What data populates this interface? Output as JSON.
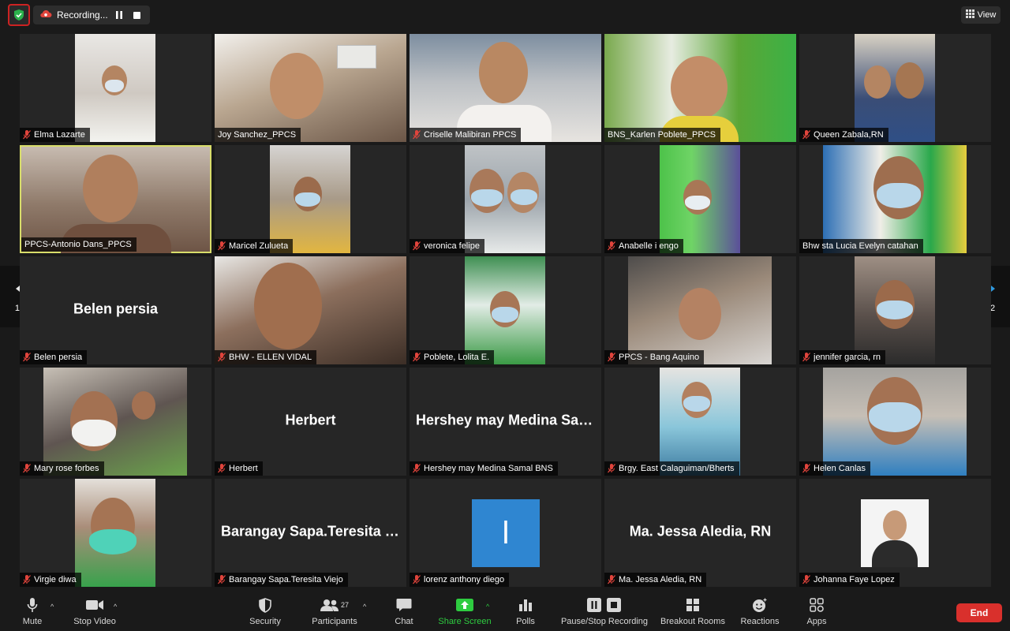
{
  "topbar": {
    "recording_label": "Recording...",
    "view_label": "View"
  },
  "navigation": {
    "page_left": "1/2",
    "page_right": "1/2"
  },
  "participants": [
    {
      "name": "Elma Lazarte",
      "mic_muted": true
    },
    {
      "name": "Joy Sanchez_PPCS",
      "mic_muted": false
    },
    {
      "name": "Criselle Malibiran PPCS",
      "mic_muted": true
    },
    {
      "name": "BNS_Karlen Poblete_PPCS",
      "mic_muted": false
    },
    {
      "name": "Queen Zabala,RN",
      "mic_muted": true
    },
    {
      "name": "PPCS-Antonio Dans_PPCS",
      "mic_muted": false
    },
    {
      "name": "Maricel Zulueta",
      "mic_muted": true
    },
    {
      "name": "veronica felipe",
      "mic_muted": true
    },
    {
      "name": "Anabelle i engo",
      "mic_muted": true
    },
    {
      "name": "Bhw sta Lucia Evelyn catahan",
      "mic_muted": false
    },
    {
      "name": "Belen persia",
      "mic_muted": true,
      "center_label": "Belen persia"
    },
    {
      "name": "BHW - ELLEN VIDAL",
      "mic_muted": true
    },
    {
      "name": "Poblete, Lolita E.",
      "mic_muted": true
    },
    {
      "name": "PPCS - Bang Aquino",
      "mic_muted": true
    },
    {
      "name": "jennifer garcia, rn",
      "mic_muted": true
    },
    {
      "name": "Mary rose forbes",
      "mic_muted": true
    },
    {
      "name": "Herbert",
      "mic_muted": true,
      "center_label": "Herbert"
    },
    {
      "name": "Hershey may Medina Samal BNS",
      "mic_muted": true,
      "center_label": "Hershey may Medina Sama..."
    },
    {
      "name": "Brgy. East Calaguiman/Bherts",
      "mic_muted": true
    },
    {
      "name": "Helen Canlas",
      "mic_muted": true
    },
    {
      "name": "Virgie diwa",
      "mic_muted": true
    },
    {
      "name": "Barangay Sapa.Teresita Viejo",
      "mic_muted": true,
      "center_label": "Barangay Sapa.Teresita Viejo"
    },
    {
      "name": "lorenz anthony diego",
      "mic_muted": true,
      "avatar_letter": "l"
    },
    {
      "name": "Ma. Jessa Aledia, RN",
      "mic_muted": true,
      "center_label": "Ma. Jessa Aledia, RN"
    },
    {
      "name": "Johanna Faye Lopez",
      "mic_muted": true
    }
  ],
  "toolbar": {
    "mute": "Mute",
    "stop_video": "Stop Video",
    "security": "Security",
    "participants": "Participants",
    "participants_count": "27",
    "chat": "Chat",
    "share_screen": "Share Screen",
    "polls": "Polls",
    "pause_stop_recording": "Pause/Stop Recording",
    "breakout_rooms": "Breakout Rooms",
    "reactions": "Reactions",
    "apps": "Apps",
    "end": "End"
  },
  "colors": {
    "background": "#1a1a1a",
    "tile": "#262626",
    "active_speaker_border": "#d8dd6a",
    "end_button": "#d9302c",
    "share_screen_green": "#2ecc40",
    "avatar_blue": "#2f86d1",
    "recording_red": "#e0443c"
  }
}
